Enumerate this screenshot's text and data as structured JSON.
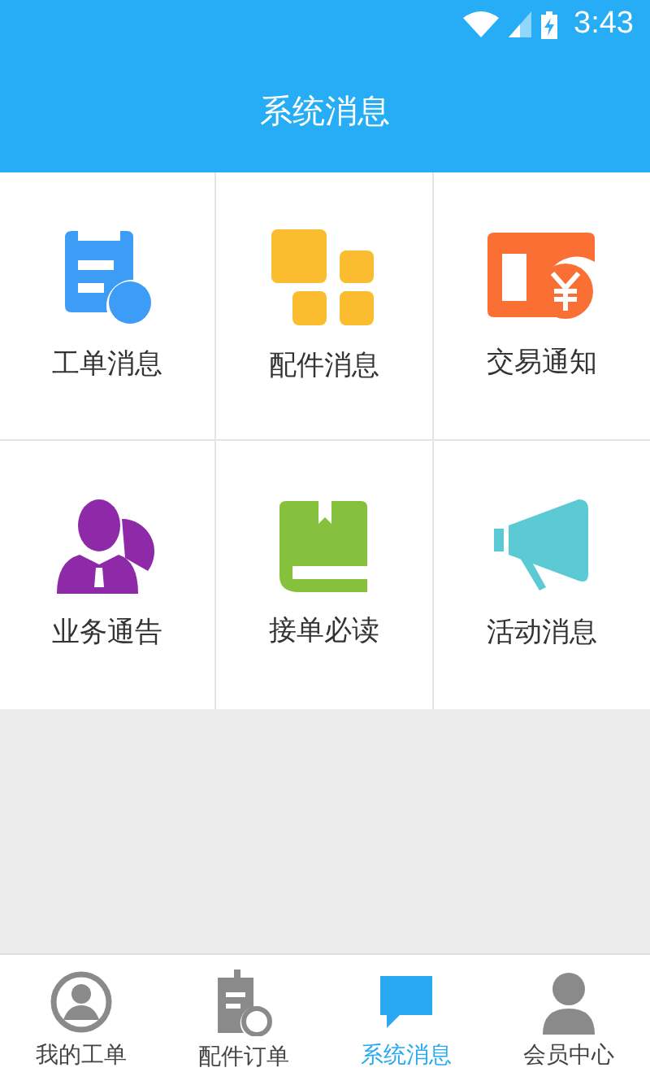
{
  "status_bar": {
    "time": "3:43"
  },
  "header": {
    "title": "系统消息"
  },
  "grid": [
    {
      "label": "工单消息",
      "kind": "order"
    },
    {
      "label": "配件消息",
      "kind": "parts"
    },
    {
      "label": "交易通知",
      "kind": "trade"
    },
    {
      "label": "业务通告",
      "kind": "business"
    },
    {
      "label": "接单必读",
      "kind": "book"
    },
    {
      "label": "活动消息",
      "kind": "megaphone"
    }
  ],
  "tabs": [
    {
      "label": "我的工单",
      "kind": "person",
      "selected": false
    },
    {
      "label": "配件订单",
      "kind": "clipboard",
      "selected": false
    },
    {
      "label": "系统消息",
      "kind": "message",
      "selected": true
    },
    {
      "label": "会员中心",
      "kind": "member",
      "selected": false
    }
  ]
}
